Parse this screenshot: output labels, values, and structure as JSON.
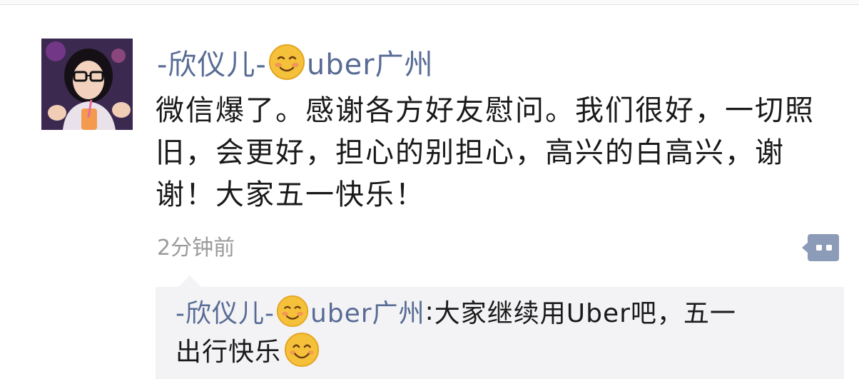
{
  "post": {
    "author_prefix": "-欣仪儿-",
    "author_suffix": "uber广州",
    "author_emoji": "blushing-smile-emoji",
    "text": "微信爆了。感谢各方好友慰问。我们很好，一切照旧，会更好，担心的别担心，高兴的白高兴，谢谢！大家五一快乐！",
    "timestamp": "2分钟前"
  },
  "comment": {
    "author_prefix": "-欣仪儿-",
    "author_suffix": "uber广州",
    "separator": ": ",
    "text_line1": "大家继续用Uber吧，五一",
    "text_line2": "出行快乐",
    "trailing_emoji": "smile-emoji"
  },
  "colors": {
    "name_link": "#576b95",
    "body_text": "#1a1a1a",
    "timestamp": "#9b9b9b",
    "comment_bg": "#f3f3f5",
    "action_button": "#8c9bb8",
    "emoji_face": "#f5c13a"
  },
  "icons": {
    "comment_action": "comment-bubble-icon",
    "avatar": "user-avatar"
  }
}
